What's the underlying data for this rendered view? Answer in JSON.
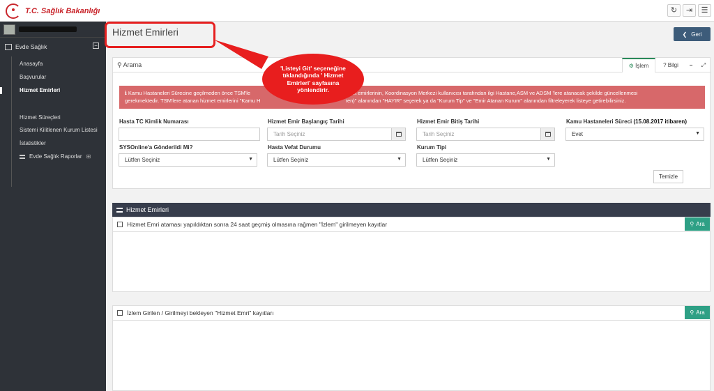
{
  "app": {
    "logo_text": "T.C. Sağlık Bakanlığı"
  },
  "topbar": {
    "refresh_icon": "↻",
    "logout_icon": "⇥",
    "menu_icon": "☰"
  },
  "sidebar": {
    "user_name": "████████",
    "section_label": "Evde Sağlık",
    "items": [
      {
        "label": "Anasayfa"
      },
      {
        "label": "Başvurular"
      },
      {
        "label": "Hizmet Emirleri"
      },
      {
        "label": "Hizmet Süreçleri"
      },
      {
        "label": "Sistemi Kilitlenen Kurum Listesi"
      },
      {
        "label": "İstatistikler"
      },
      {
        "label": "Evde Sağlık Raporlar"
      }
    ]
  },
  "main": {
    "page_title": "Hizmet Emirleri",
    "back_label": "Geri",
    "callout": "'Listeyi Git' seçeneğine tıklandığında ' Hizmet Emirleri' sayfasına yönlendirir.",
    "search": {
      "title": "Arama",
      "tabs": [
        {
          "label": "İşlem"
        },
        {
          "label": "Bilgi"
        }
      ],
      "alert_line1": "ℹ Kamu Hastaneleri Sürecine geçilmeden önce TSM'le",
      "alert_line1b": "hizmet emirlerinin, Koordinasyon Merkezi kullanıcısı tarafından ilgi Hastane,ASM ve ADSM 'lere atanacak şekilde güncellenmesi",
      "alert_line2a": "gerekmektedir. TSM'lere atanan hizmet emirlerini \"Kamu H",
      "alert_line2b": "ren)\" alanından \"HAYIR\" seçerek ya da \"Kurum Tip\" ve \"Emir Atanan Kurum\" alanından filtreleyerek listeye getirebilirsiniz.",
      "fields": {
        "tc_label": "Hasta TC Kimlik Numarası",
        "start_label": "Hizmet Emir Başlangıç Tarihi",
        "start_placeholder": "Tarih Seçiniz",
        "end_label": "Hizmet Emir Bitiş Tarihi",
        "end_placeholder": "Tarih Seçiniz",
        "kamu_label": "Kamu Hastaneleri Süreci",
        "kamu_label_suffix": "(15.08.2017 itibaren)",
        "kamu_value": "Evet",
        "sys_label": "SYSOnline'a Gönderildi Mi?",
        "sys_value": "Lütfen Seçiniz",
        "vefat_label": "Hasta Vefat Durumu",
        "vefat_value": "Lütfen Seçiniz",
        "kurum_label": "Kurum Tipi",
        "kurum_value": "Lütfen Seçiniz"
      },
      "clear_label": "Temizle"
    },
    "results": {
      "title": "Hizmet Emirleri",
      "panel1": "Hizmet Emri ataması yapıldıktan sonra 24 saat geçmiş olmasına rağmen \"İzlem\" girilmeyen kayıtlar",
      "panel2": "İzlem Girilen / Girilmeyi bekleyen \"Hizmet Emri\" kayıtları",
      "search_label": "Ara"
    }
  }
}
